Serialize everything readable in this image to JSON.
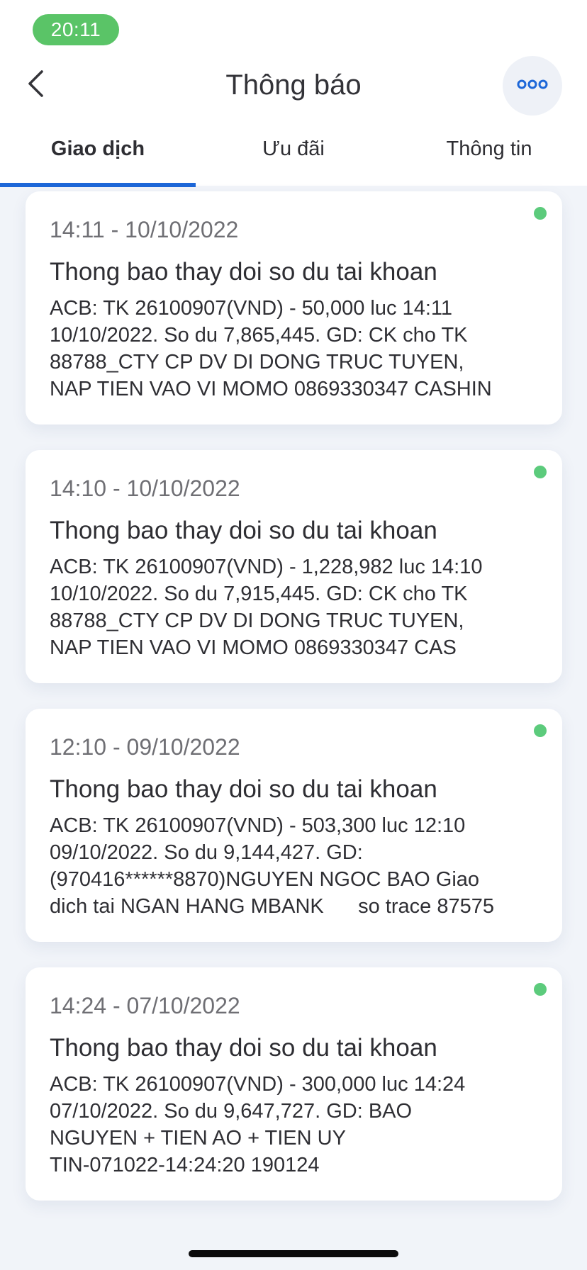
{
  "status_bar": {
    "time": "20:11"
  },
  "header": {
    "title": "Thông báo",
    "back_icon": "chevron-left-icon",
    "more_icon": "more-dots-icon"
  },
  "tabs": [
    {
      "label": "Giao dịch",
      "active": true
    },
    {
      "label": "Ưu đãi",
      "active": false
    },
    {
      "label": "Thông tin",
      "active": false
    }
  ],
  "colors": {
    "accent": "#1d67d8",
    "unread_dot": "#5ccb7c",
    "status_pill": "#5ac467"
  },
  "notifications": [
    {
      "time": "14:11 - 10/10/2022",
      "title": "Thong bao thay doi so du tai khoan",
      "lines": [
        "ACB: TK 26100907(VND) - 50,000 luc 14:11",
        "10/10/2022. So du 7,865,445. GD: CK cho TK",
        "88788_CTY CP DV DI DONG TRUC TUYEN,",
        "NAP TIEN VAO VI MOMO 0869330347 CASHIN"
      ],
      "unread": true
    },
    {
      "time": "14:10 - 10/10/2022",
      "title": "Thong bao thay doi so du tai khoan",
      "lines": [
        "ACB: TK 26100907(VND) - 1,228,982 luc 14:10",
        "10/10/2022. So du 7,915,445. GD: CK cho TK",
        "88788_CTY CP DV DI DONG TRUC TUYEN,",
        "NAP TIEN VAO VI MOMO 0869330347 CAS"
      ],
      "unread": true
    },
    {
      "time": "12:10 - 09/10/2022",
      "title": "Thong bao thay doi so du tai khoan",
      "lines": [
        "ACB: TK 26100907(VND) - 503,300 luc 12:10",
        "09/10/2022. So du 9,144,427. GD:",
        "(970416******8870)NGUYEN NGOC BAO Giao",
        "dich tai NGAN HANG MBANK      so trace 87575"
      ],
      "unread": true
    },
    {
      "time": "14:24 - 07/10/2022",
      "title": "Thong bao thay doi so du tai khoan",
      "lines": [
        "ACB: TK 26100907(VND) - 300,000 luc 14:24",
        "07/10/2022. So du 9,647,727. GD: BAO",
        "NGUYEN + TIEN AO + TIEN UY",
        "TIN-071022-14:24:20 190124"
      ],
      "unread": true
    }
  ]
}
